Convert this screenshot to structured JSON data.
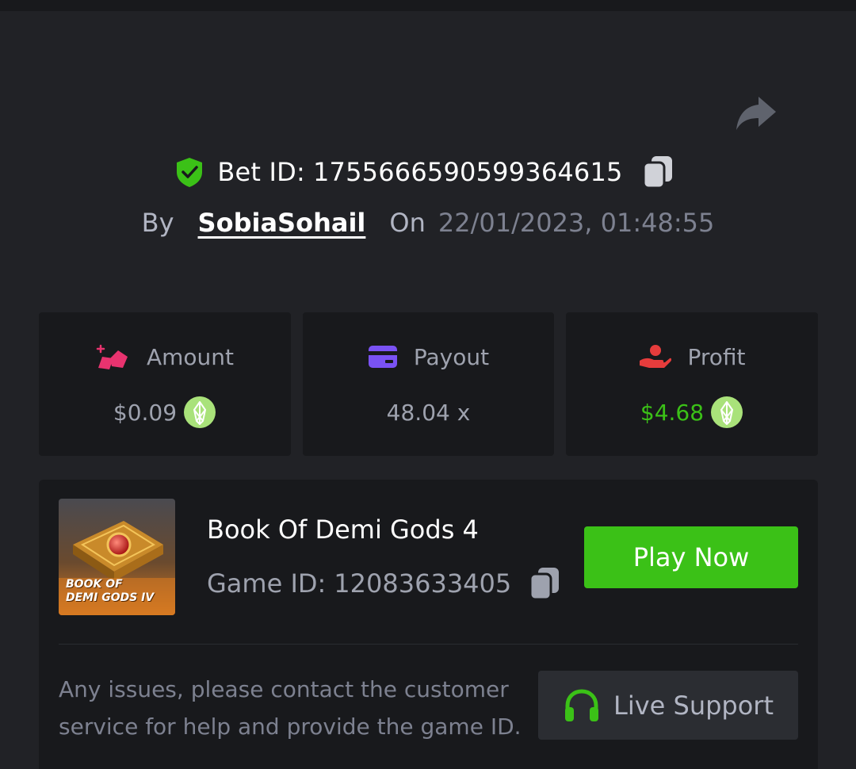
{
  "bet": {
    "label": "Bet ID:",
    "id": "1755666590599364615",
    "by_label": "By",
    "username": "SobiaSohail",
    "on_label": "On",
    "datetime": "22/01/2023, 01:48:55"
  },
  "stats": [
    {
      "label": "Amount",
      "value": "$0.09",
      "icon": "amount-icon",
      "coin": true
    },
    {
      "label": "Payout",
      "value": "48.04 x",
      "icon": "payout-card-icon",
      "coin": false
    },
    {
      "label": "Profit",
      "value": "$4.68",
      "icon": "profit-hand-icon",
      "coin": true
    }
  ],
  "game": {
    "name": "Book Of Demi Gods 4",
    "id_label": "Game ID:",
    "id": "12083633405",
    "thumbnail_text_line1": "BOOK OF",
    "thumbnail_text_line2": "DEMI GODS IV",
    "play_label": "Play Now"
  },
  "support": {
    "help_text": "Any issues, please contact the customer service for help and provide the game ID.",
    "button_label": "Live Support"
  },
  "colors": {
    "background": "#212226",
    "card": "#18191c",
    "accent_green": "#3bc117",
    "muted": "#9ea2ae",
    "amount_pink": "#e8336f",
    "payout_purple": "#7a52f4",
    "profit_red": "#e63c3c",
    "coin_green": "#a9e27a"
  }
}
